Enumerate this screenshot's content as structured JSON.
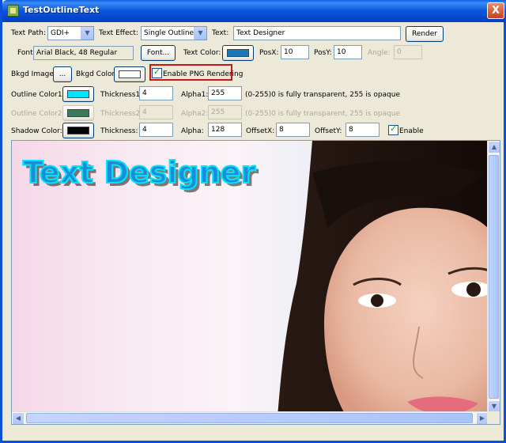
{
  "window": {
    "title": "TestOutlineText",
    "close_glyph": "X"
  },
  "row1": {
    "text_path_label": "Text Path:",
    "text_path_value": "GDI+",
    "text_effect_label": "Text Effect:",
    "text_effect_value": "Single Outline",
    "text_label": "Text:",
    "text_value": "Text Designer",
    "render_label": "Render"
  },
  "row2": {
    "font_label": "Font:",
    "font_value": "Arial Black, 48 Regular",
    "font_button": "Font...",
    "text_color_label": "Text Color:",
    "text_color": "#1a78b4",
    "posx_label": "PosX:",
    "posx_value": "10",
    "posy_label": "PosY:",
    "posy_value": "10",
    "angle_label": "Angle:",
    "angle_value": "0"
  },
  "row3": {
    "bkgd_image_label": "Bkgd Image:",
    "browse_label": "...",
    "bkgd_color_label": "Bkgd Color:",
    "bkgd_color": "#ffffff",
    "png_label": "Enable PNG Rendering"
  },
  "row4": {
    "outline1_label": "Outline Color1:",
    "outline1_color": "#00e5ff",
    "thickness1_label": "Thickness1:",
    "thickness1_value": "4",
    "alpha1_label": "Alpha1:",
    "alpha1_value": "255",
    "hint": "(0-255)0 is fully transparent, 255 is opaque"
  },
  "row5": {
    "outline2_label": "Outline Color2:",
    "outline2_color": "#3a7a5a",
    "thickness2_label": "Thickness2:",
    "thickness2_value": "4",
    "alpha2_label": "Alpha2:",
    "alpha2_value": "255",
    "hint": "(0-255)0 is fully transparent, 255 is opaque"
  },
  "row6": {
    "shadow_label": "Shadow Color:",
    "shadow_color": "#000000",
    "thickness_label": "Thickness:",
    "thickness_value": "4",
    "alpha_label": "Alpha:",
    "alpha_value": "128",
    "offsetx_label": "OffsetX:",
    "offsetx_value": "8",
    "offsety_label": "OffsetY:",
    "offsety_value": "8",
    "enable_label": "Enable"
  },
  "preview": {
    "rendered_text": "Text Designer",
    "text_fill": "#1b8dd6",
    "outline": "#00e5ff"
  },
  "icons": {
    "app": "app-icon",
    "close": "close-icon",
    "dropdown": "chevron-down-icon",
    "check": "check-icon"
  }
}
